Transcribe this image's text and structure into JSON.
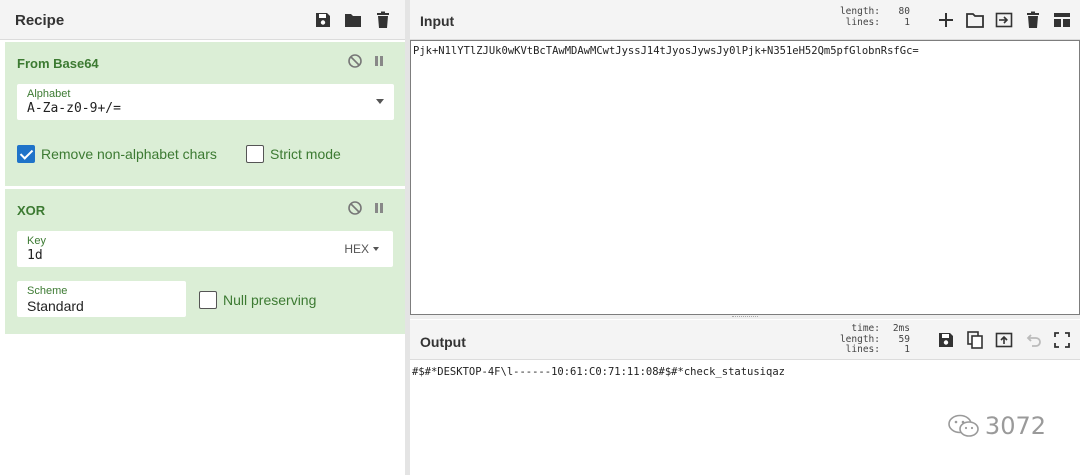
{
  "recipe": {
    "title": "Recipe",
    "icons": [
      "save-icon",
      "folder-icon",
      "trash-icon"
    ],
    "operations": [
      {
        "name": "From Base64",
        "alphabet_label": "Alphabet",
        "alphabet_value": "A-Za-z0-9+/=",
        "remove_non_alpha_label": "Remove non-alphabet chars",
        "remove_non_alpha_checked": true,
        "strict_mode_label": "Strict mode",
        "strict_mode_checked": false
      },
      {
        "name": "XOR",
        "key_label": "Key",
        "key_value": "1d",
        "key_format": "HEX",
        "scheme_label": "Scheme",
        "scheme_value": "Standard",
        "null_preserving_label": "Null preserving",
        "null_preserving_checked": false
      }
    ]
  },
  "input": {
    "title": "Input",
    "length_label": "length:",
    "length_value": "80",
    "lines_label": "lines:",
    "lines_value": "1",
    "text": "Pjk+N1lYTlZJUk0wKVtBcTAwMDAwMCwtJyssJ14tJyosJywsJy0lPjk+N351eH52Qm5pfGlobnRsfGc="
  },
  "output": {
    "title": "Output",
    "time_label": "time:",
    "time_value": "2ms",
    "length_label": "length:",
    "length_value": "59",
    "lines_label": "lines:",
    "lines_value": "1",
    "text": "#$#*DESKTOP-4F\\l------10:61:C0:71:11:08#$#*check_statusiqaz"
  },
  "watermark": {
    "text": "3072"
  },
  "colors": {
    "operation_bg": "#dbeed6",
    "label_green": "#3c7a32",
    "checkbox_blue": "#1f73c9"
  }
}
